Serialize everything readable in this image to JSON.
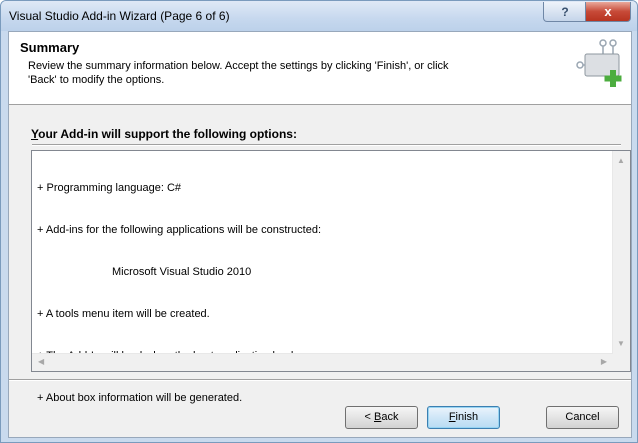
{
  "window": {
    "title": "Visual Studio Add-in Wizard (Page 6 of 6)"
  },
  "titlebar": {
    "help_label": "?",
    "close_label": "x"
  },
  "header": {
    "title": "Summary",
    "desc_line1": "Review the summary information below. Accept the settings by clicking 'Finish', or click",
    "desc_line2": "'Back' to modify the options."
  },
  "group": {
    "label_first": "Y",
    "label_rest": "our Add-in will support the following options:"
  },
  "summary": {
    "line1": "+ Programming language: C#",
    "line2": "+ Add-ins for the following applications will be constructed:",
    "line3": "Microsoft Visual Studio 2010",
    "line4": "+ A tools menu item will be created.",
    "line5": "+ The Add-In will load when the host application loads.",
    "line6": "+ About box information will be generated."
  },
  "buttons": {
    "back_prefix": "< ",
    "back_accel": "B",
    "back_rest": "ack",
    "finish_accel": "F",
    "finish_rest": "inish",
    "cancel": "Cancel"
  },
  "icons": {
    "help": "help-icon",
    "close": "close-icon",
    "wizard": "addin-wizard-icon"
  }
}
